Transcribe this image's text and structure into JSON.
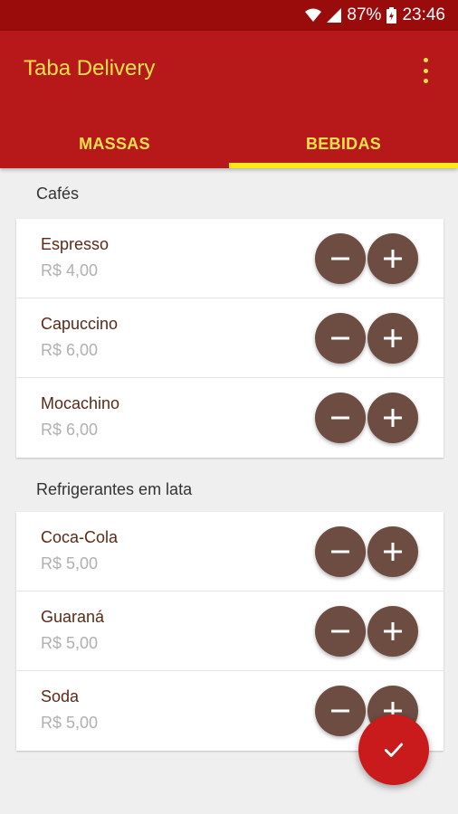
{
  "status_bar": {
    "battery": "87%",
    "time": "23:46",
    "icons": [
      "wifi-icon",
      "signal-icon",
      "battery-icon"
    ]
  },
  "app_bar": {
    "title": "Taba Delivery",
    "menu_icon": "more-vert-icon"
  },
  "tabs": [
    {
      "label": "MASSAS",
      "active": false
    },
    {
      "label": "BEBIDAS",
      "active": true
    }
  ],
  "sections": [
    {
      "title": "Cafés",
      "items": [
        {
          "name": "Espresso",
          "price": "R$ 4,00"
        },
        {
          "name": "Capuccino",
          "price": "R$ 6,00"
        },
        {
          "name": "Mocachino",
          "price": "R$ 6,00"
        }
      ]
    },
    {
      "title": "Refrigerantes em lata",
      "items": [
        {
          "name": "Coca-Cola",
          "price": "R$ 5,00"
        },
        {
          "name": "Guaraná",
          "price": "R$ 5,00"
        },
        {
          "name": "Soda",
          "price": "R$ 5,00"
        }
      ]
    }
  ],
  "fab": {
    "icon": "check-icon"
  },
  "colors": {
    "status_bar": "#9a0b0b",
    "app_bar": "#b7191a",
    "accent_text": "#ffe14a",
    "tab_indicator": "#ffe817",
    "button": "#6d4c41",
    "fab": "#c91a1c"
  }
}
